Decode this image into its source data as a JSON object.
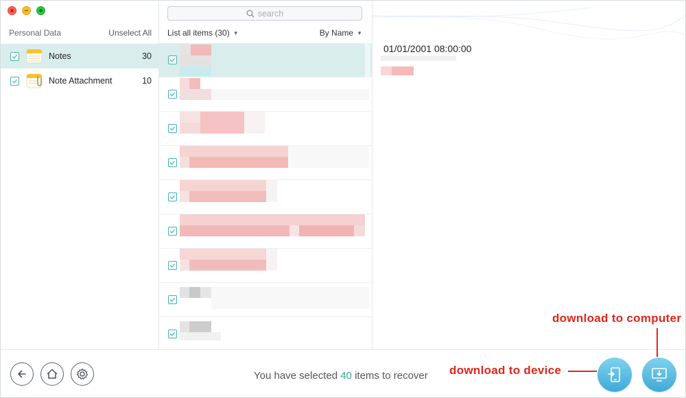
{
  "window": {
    "controls": [
      "close",
      "minimize",
      "maximize"
    ]
  },
  "sidebar": {
    "header_title": "Personal Data",
    "unselect_label": "Unselect All",
    "items": [
      {
        "label": "Notes",
        "count": "30",
        "icon": "notes-icon",
        "checked": true,
        "active": true
      },
      {
        "label": "Note Attachment",
        "count": "10",
        "icon": "note-attachment-icon",
        "checked": true,
        "active": false
      }
    ]
  },
  "list": {
    "search_placeholder": "search",
    "filter_label": "List all items (30)",
    "sort_label": "By Name",
    "rows_checked": [
      true,
      true,
      true,
      true,
      true,
      true,
      true,
      true,
      true
    ]
  },
  "detail": {
    "date": "01/01/2001 08:00:00"
  },
  "footer": {
    "status_prefix": "You have selected ",
    "status_count": "40",
    "status_suffix": " items to recover"
  },
  "annotations": {
    "device_label": "download to device",
    "computer_label": "download to computer"
  },
  "colors": {
    "accent": "#3fb6a8",
    "selection": "#d9eeec",
    "annotation": "#e0261b",
    "action_button": "#4fb8de"
  }
}
